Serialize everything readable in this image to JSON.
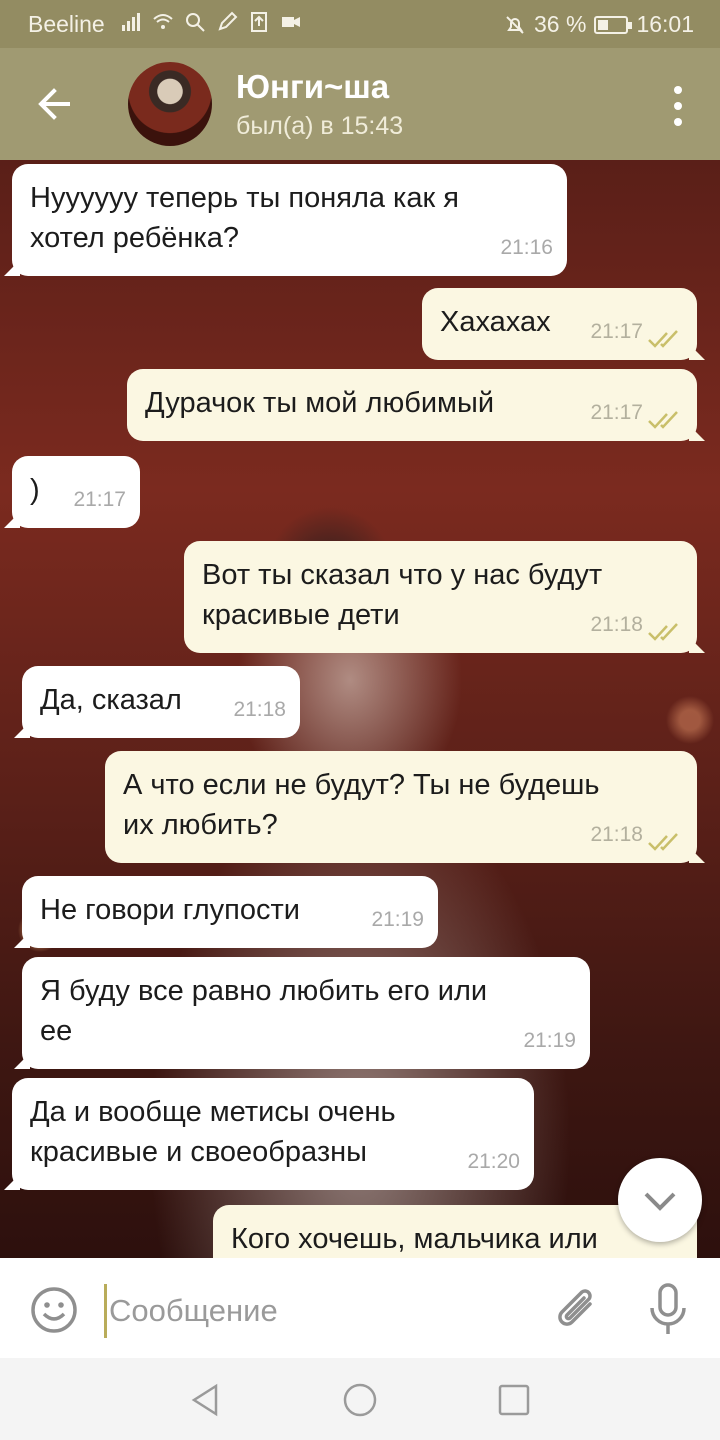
{
  "status_bar": {
    "carrier": "Beeline",
    "battery_text": "36 %",
    "battery_level": 0.36,
    "time": "16:01"
  },
  "header": {
    "title": "Юнги~ша",
    "status": "был(а) в 15:43"
  },
  "messages": [
    {
      "direction": "in",
      "text": "Нуууууу теперь ты поняла как я\nхотел ребёнка?",
      "time": "21:16"
    },
    {
      "direction": "out",
      "text": "Хахахах",
      "time": "21:17",
      "read": true
    },
    {
      "direction": "out",
      "text": "Дурачок ты мой любимый",
      "time": "21:17",
      "read": true
    },
    {
      "direction": "in",
      "text": ")",
      "time": "21:17"
    },
    {
      "direction": "out",
      "text": "Вот ты сказал что у нас будут\nкрасивые дети",
      "time": "21:18",
      "read": true
    },
    {
      "direction": "in",
      "text": "Да, сказал",
      "time": "21:18"
    },
    {
      "direction": "out",
      "text": "А что если не будут? Ты не будешь\nих любить?",
      "time": "21:18",
      "read": true
    },
    {
      "direction": "in",
      "text": "Не говори глупости",
      "time": "21:19"
    },
    {
      "direction": "in",
      "text": "Я буду все равно любить его или\nее",
      "time": "21:19"
    },
    {
      "direction": "in",
      "text": "Да и вообще метисы очень\nкрасивые и своеобразны",
      "time": "21:20"
    },
    {
      "direction": "out",
      "text": "Кого хочешь, мальчика или",
      "time": "",
      "read": false
    }
  ],
  "input": {
    "placeholder": "Сообщение"
  },
  "colors": {
    "header": "#a09a72",
    "status_bar": "#938c62",
    "incoming_bubble": "#ffffff",
    "outgoing_bubble": "#fbf7e2",
    "read_ticks": "#c9bf6a"
  },
  "icons": [
    "back-arrow-icon",
    "more-vert-icon",
    "emoji-icon",
    "attach-icon",
    "mic-icon",
    "chevron-down-icon",
    "nav-back-icon",
    "nav-home-icon",
    "nav-recents-icon"
  ]
}
